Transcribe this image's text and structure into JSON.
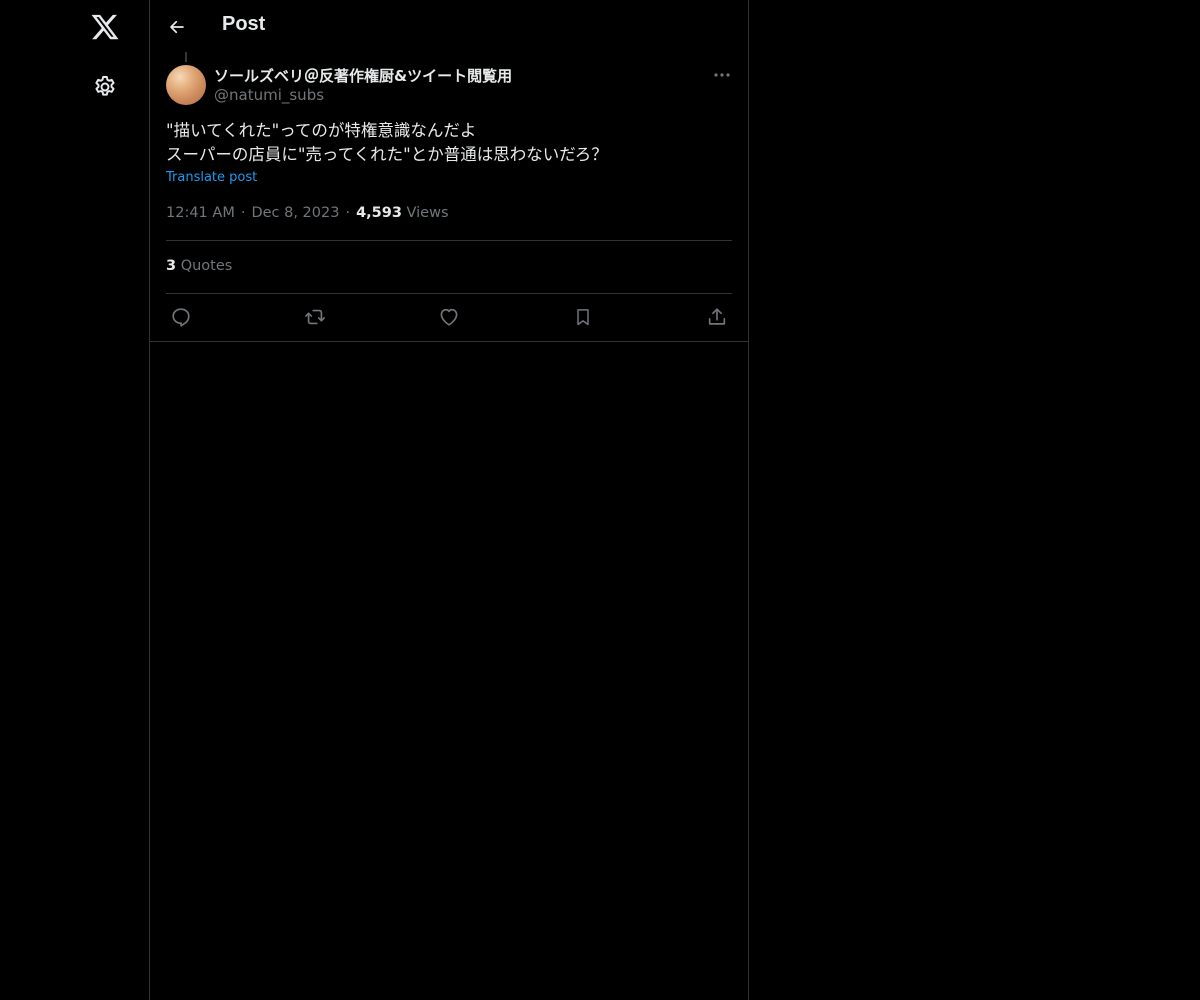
{
  "sidebar": {
    "logo_icon": "x-logo-icon",
    "settings_icon": "gear-icon"
  },
  "header": {
    "title": "Post",
    "back_icon": "arrow-left-icon"
  },
  "post": {
    "author": {
      "display_name": "ソールズベリ＠反著作権厨&ツイート閲覧用",
      "handle": "@natumi_subs"
    },
    "text_lines": [
      "\"描いてくれた\"ってのが特権意識なんだよ",
      "スーパーの店員に\"売ってくれた\"とか普通は思わないだろ？"
    ],
    "translate_label": "Translate post",
    "time": "12:41 AM",
    "separator": "·",
    "date": "Dec 8, 2023",
    "views_count": "4,593",
    "views_label": "Views",
    "quotes_count": "3",
    "quotes_label": "Quotes"
  },
  "actions": [
    {
      "icon": "reply-icon"
    },
    {
      "icon": "repost-icon"
    },
    {
      "icon": "like-icon"
    },
    {
      "icon": "bookmark-icon"
    },
    {
      "icon": "share-icon"
    }
  ],
  "colors": {
    "background": "#000000",
    "text": "#e7e9ea",
    "muted": "#71767b",
    "accent": "#1d9bf0",
    "border": "#2f3336"
  }
}
